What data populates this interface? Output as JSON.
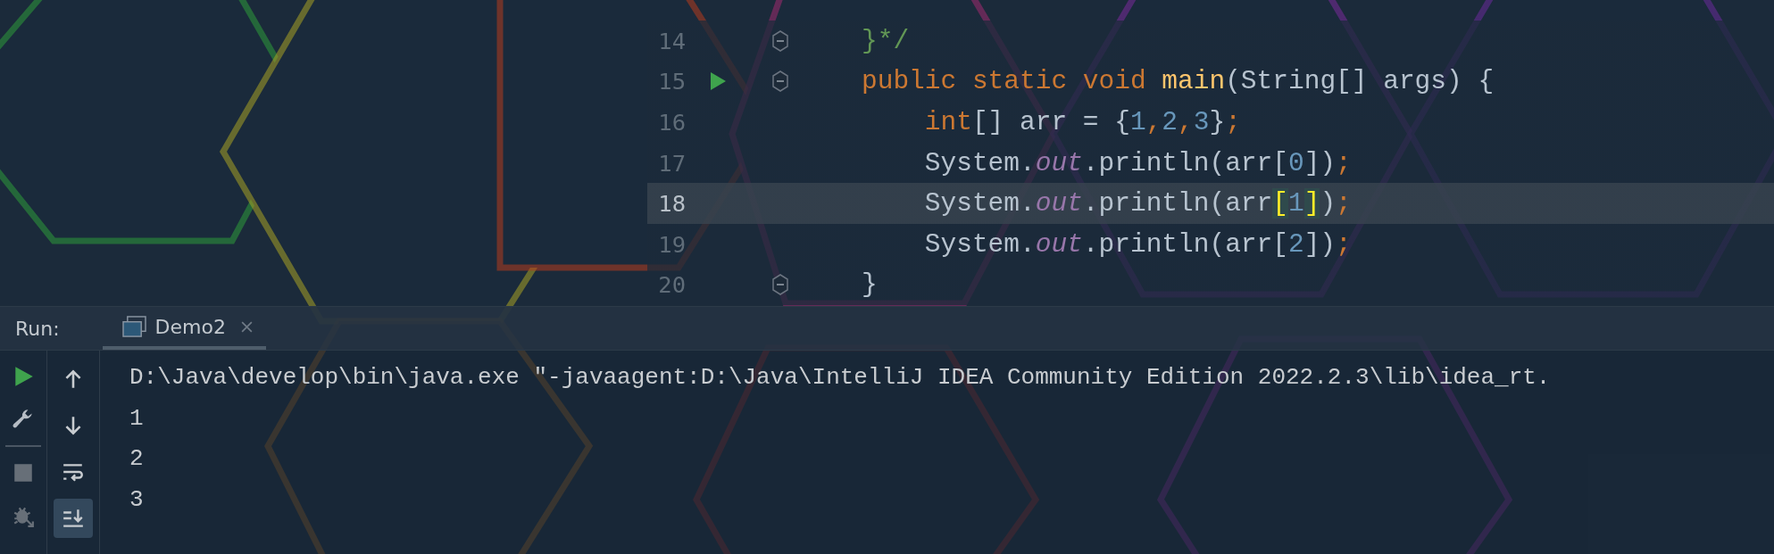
{
  "editor": {
    "lines": [
      {
        "number": "14",
        "current": false,
        "run": false,
        "fold": true,
        "tokens": [
          {
            "kind": "comment",
            "text": "}*/"
          }
        ]
      },
      {
        "number": "15",
        "current": false,
        "run": true,
        "fold": true,
        "tokens": [
          {
            "kind": "keyword",
            "text": "public static void "
          },
          {
            "kind": "method",
            "text": "main"
          },
          {
            "kind": "plain",
            "text": "(String[] args) {"
          }
        ],
        "children": [
          {
            "number": "16",
            "current": false,
            "run": false,
            "fold": false,
            "tokens": [
              {
                "kind": "keyword",
                "text": "int"
              },
              {
                "kind": "plain",
                "text": "[] arr = {"
              },
              {
                "kind": "number",
                "text": "1"
              },
              {
                "kind": "keyword",
                "text": ","
              },
              {
                "kind": "number",
                "text": "2"
              },
              {
                "kind": "keyword",
                "text": ","
              },
              {
                "kind": "number",
                "text": "3"
              },
              {
                "kind": "plain",
                "text": "}"
              },
              {
                "kind": "keyword",
                "text": ";"
              }
            ]
          },
          {
            "number": "17",
            "current": false,
            "run": false,
            "fold": false,
            "tokens": [
              {
                "kind": "plain",
                "text": "System."
              },
              {
                "kind": "field",
                "text": "out"
              },
              {
                "kind": "plain",
                "text": ".println(arr["
              },
              {
                "kind": "number",
                "text": "0"
              },
              {
                "kind": "plain",
                "text": "])"
              },
              {
                "kind": "keyword",
                "text": ";"
              }
            ]
          },
          {
            "number": "18",
            "current": true,
            "run": false,
            "fold": false,
            "tokens": [
              {
                "kind": "plain",
                "text": "System."
              },
              {
                "kind": "field",
                "text": "out"
              },
              {
                "kind": "plain",
                "text": ".println(arr"
              },
              {
                "kind": "brace_match",
                "text": "["
              },
              {
                "kind": "number",
                "text": "1"
              },
              {
                "kind": "brace_match",
                "text": "]"
              },
              {
                "kind": "plain",
                "text": ")"
              },
              {
                "kind": "keyword",
                "text": ";"
              }
            ]
          },
          {
            "number": "19",
            "current": false,
            "run": false,
            "fold": false,
            "tokens": [
              {
                "kind": "plain",
                "text": "System."
              },
              {
                "kind": "field",
                "text": "out"
              },
              {
                "kind": "plain",
                "text": ".println(arr["
              },
              {
                "kind": "number",
                "text": "2"
              },
              {
                "kind": "plain",
                "text": "])"
              },
              {
                "kind": "keyword",
                "text": ";"
              }
            ]
          }
        ]
      },
      {
        "number": "20",
        "current": false,
        "run": false,
        "fold": true,
        "tokens": [
          {
            "kind": "plain",
            "text": "}"
          }
        ]
      }
    ]
  },
  "run_panel": {
    "label": "Run:",
    "tabs": [
      {
        "label": "Demo2",
        "selected": true
      }
    ],
    "left_tools": [
      {
        "kind": "run",
        "disabled": false
      },
      {
        "kind": "wrench",
        "disabled": false
      },
      {
        "kind": "stop",
        "disabled": true
      },
      {
        "kind": "debug",
        "disabled": true
      }
    ],
    "right_tools": [
      {
        "kind": "up",
        "selected": false
      },
      {
        "kind": "down",
        "selected": false
      },
      {
        "kind": "wrap",
        "selected": false
      },
      {
        "kind": "scroll_end",
        "selected": true
      }
    ],
    "console": [
      "D:\\Java\\develop\\bin\\java.exe \"-javaagent:D:\\Java\\IntelliJ IDEA Community Edition 2022.2.3\\lib\\idea_rt.",
      "1",
      "2",
      "3"
    ]
  }
}
